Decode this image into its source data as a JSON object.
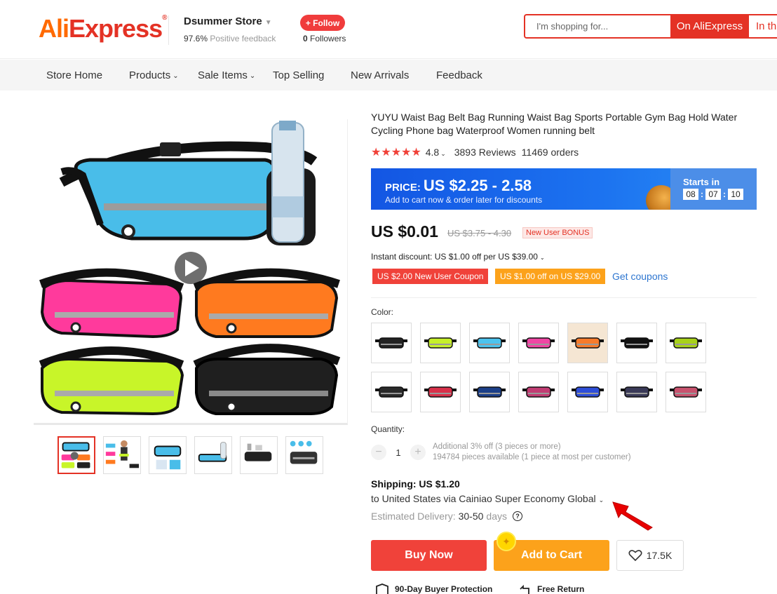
{
  "header": {
    "logo": "AliExpress",
    "store_name": "Dsummer Store",
    "feedback_pct": "97.6%",
    "feedback_label": "Positive feedback",
    "follow_label": "+ Follow",
    "followers_count": "0",
    "followers_label": "Followers",
    "search_placeholder": "I'm shopping for...",
    "search_on_aliexpress": "On AliExpress",
    "search_in_store": "In th"
  },
  "nav": {
    "items": [
      "Store Home",
      "Products",
      "Sale Items",
      "Top Selling",
      "New Arrivals",
      "Feedback"
    ]
  },
  "product": {
    "title": "YUYU Waist Bag Belt Bag Running Waist Bag Sports Portable Gym Bag Hold Water Cycling Phone bag Waterproof Women running belt",
    "rating": "4.8",
    "stars": 5,
    "reviews": "3893 Reviews",
    "orders": "11469 orders"
  },
  "price_banner": {
    "price_label": "PRICE:",
    "price_value": "US $2.25 - 2.58",
    "subtitle": "Add to cart now & order later for discounts",
    "starts_in": "Starts in",
    "countdown": [
      "08",
      "07",
      "10"
    ]
  },
  "pricing": {
    "current": "US $0.01",
    "original": "US $3.75 - 4.30",
    "badge": "New User BONUS",
    "instant_discount": "Instant discount: US $1.00 off per US $39.00",
    "coupon_red": "US $2.00 New User Coupon",
    "coupon_orange": "US $1.00 off on US $29.00",
    "get_coupons": "Get coupons"
  },
  "color": {
    "label": "Color:",
    "swatches": [
      "#222222",
      "#c6f02a",
      "#4cc3ee",
      "#f046a4",
      "#f77b2b",
      "#111111",
      "#a8d21a",
      "#2a2a2a",
      "#d8304a",
      "#1c3f88",
      "#c23c73",
      "#2e4ed8",
      "#3a3a58",
      "#c8526e"
    ]
  },
  "quantity": {
    "label": "Quantity:",
    "value": "1",
    "minus": "−",
    "plus": "+",
    "info1": "Additional 3% off (3 pieces or more)",
    "info2": "194784 pieces available (1 piece at most per customer)"
  },
  "shipping": {
    "title": "Shipping: US $1.20",
    "via": "to United States via Cainiao Super Economy Global",
    "delivery_label": "Estimated Delivery:",
    "delivery_value": "30-50",
    "delivery_unit": "days"
  },
  "actions": {
    "buy_now": "Buy Now",
    "add_to_cart": "Add to Cart",
    "wishlist_count": "17.5K"
  },
  "guarantees": {
    "protection": "90-Day Buyer Protection",
    "free_return": "Free Return"
  },
  "colors": {
    "brand_red": "#e43225",
    "buy_red": "#f0423a",
    "cart_orange": "#fca21b",
    "banner_blue": "#1c6af0",
    "link_blue": "#2e76d0"
  }
}
